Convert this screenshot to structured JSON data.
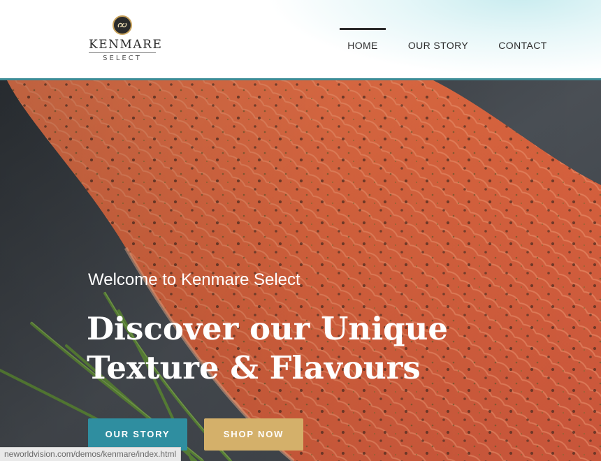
{
  "brand": {
    "name": "KENMARE",
    "sub": "SELECT",
    "colors": {
      "teal": "#2f8ea0",
      "gold": "#d4b06a",
      "dark": "#2b2b2b",
      "rule": "#3d8c96"
    }
  },
  "nav": {
    "items": [
      {
        "label": "HOME",
        "active": true
      },
      {
        "label": "OUR STORY",
        "active": false
      },
      {
        "label": "CONTACT",
        "active": false
      }
    ]
  },
  "hero": {
    "welcome": "Welcome to Kenmare Select",
    "headline_line1": "Discover our Unique",
    "headline_line2": "Texture & Flavours",
    "buttons": {
      "our_story": "OUR STORY",
      "shop_now": "SHOP NOW"
    },
    "image": "salmon-fillet-with-chives"
  },
  "statusbar": {
    "url": "neworldvision.com/demos/kenmare/index.html"
  }
}
